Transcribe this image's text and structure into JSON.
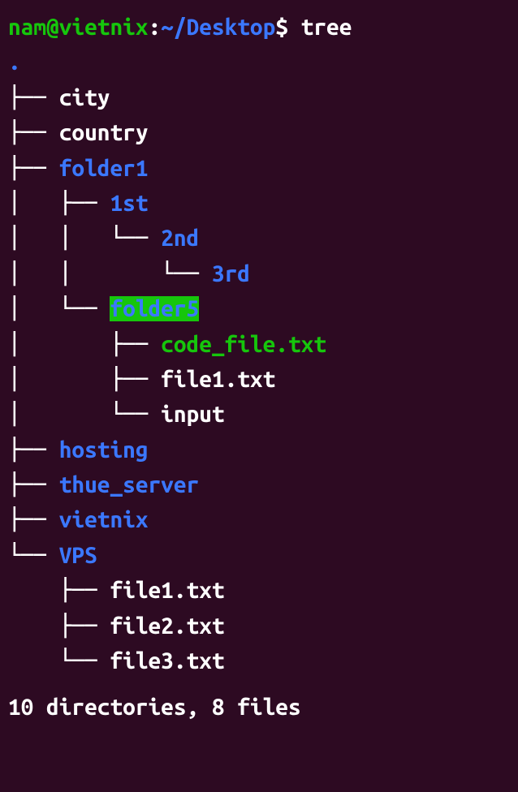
{
  "prompt": {
    "user_host": "nam@vietnix",
    "colon": ":",
    "path": "~/Desktop",
    "dollar": "$ ",
    "command": "tree"
  },
  "root_dot": ".",
  "tree": {
    "l1": {
      "branch": "├── ",
      "name": "city"
    },
    "l2": {
      "branch": "├── ",
      "name": "country"
    },
    "l3": {
      "branch": "├── ",
      "name": "folder1"
    },
    "l4": {
      "branch": "│   ├── ",
      "name": "1st"
    },
    "l5": {
      "branch": "│   │   └── ",
      "name": "2nd"
    },
    "l6": {
      "branch": "│   │       └── ",
      "name": "3rd"
    },
    "l7": {
      "branch": "│   └── ",
      "name": "folder5"
    },
    "l8": {
      "branch": "│       ├── ",
      "name": "code_file.txt"
    },
    "l9": {
      "branch": "│       ├── ",
      "name": "file1.txt"
    },
    "l10": {
      "branch": "│       └── ",
      "name": "input"
    },
    "l11": {
      "branch": "├── ",
      "name": "hosting"
    },
    "l12": {
      "branch": "├── ",
      "name": "thue_server"
    },
    "l13": {
      "branch": "├── ",
      "name": "vietnix"
    },
    "l14": {
      "branch": "└── ",
      "name": "VPS"
    },
    "l15": {
      "branch": "    ├── ",
      "name": "file1.txt"
    },
    "l16": {
      "branch": "    ├── ",
      "name": "file2.txt"
    },
    "l17": {
      "branch": "    └── ",
      "name": "file3.txt"
    }
  },
  "summary": "10 directories, 8 files"
}
